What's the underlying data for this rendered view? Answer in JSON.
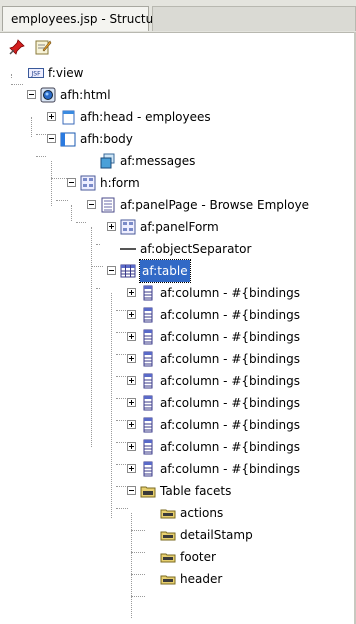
{
  "tab": {
    "title": "employees.jsp - Structure",
    "icon": "structure-icon"
  },
  "toolbar": {
    "buttons": [
      {
        "icon": "pin-icon"
      },
      {
        "icon": "edit-icon"
      }
    ]
  },
  "tree": [
    {
      "label": "f:view",
      "icon": "jsf-icon"
    },
    {
      "label": "afh:html",
      "icon": "globe-icon"
    },
    {
      "label": "afh:head - employees",
      "icon": "head-icon"
    },
    {
      "label": "afh:body",
      "icon": "body-icon"
    },
    {
      "label": "af:messages",
      "icon": "messages-icon"
    },
    {
      "label": "h:form",
      "icon": "form-icon"
    },
    {
      "label": "af:panelPage - Browse Employe",
      "icon": "page-icon"
    },
    {
      "label": "af:panelForm",
      "icon": "form-icon"
    },
    {
      "label": "af:objectSeparator",
      "icon": "separator-icon"
    },
    {
      "label": "af:table",
      "icon": "table-icon"
    },
    {
      "label": "af:column - #{bindings",
      "icon": "column-icon"
    },
    {
      "label": "af:column - #{bindings",
      "icon": "column-icon"
    },
    {
      "label": "af:column - #{bindings",
      "icon": "column-icon"
    },
    {
      "label": "af:column - #{bindings",
      "icon": "column-icon"
    },
    {
      "label": "af:column - #{bindings",
      "icon": "column-icon"
    },
    {
      "label": "af:column - #{bindings",
      "icon": "column-icon"
    },
    {
      "label": "af:column - #{bindings",
      "icon": "column-icon"
    },
    {
      "label": "af:column - #{bindings",
      "icon": "column-icon"
    },
    {
      "label": "af:column - #{bindings",
      "icon": "column-icon"
    },
    {
      "label": "Table facets",
      "icon": "folder-icon"
    },
    {
      "label": "actions",
      "icon": "facet-icon"
    },
    {
      "label": "detailStamp",
      "icon": "facet-icon"
    },
    {
      "label": "footer",
      "icon": "facet-icon"
    },
    {
      "label": "header",
      "icon": "facet-icon"
    }
  ]
}
